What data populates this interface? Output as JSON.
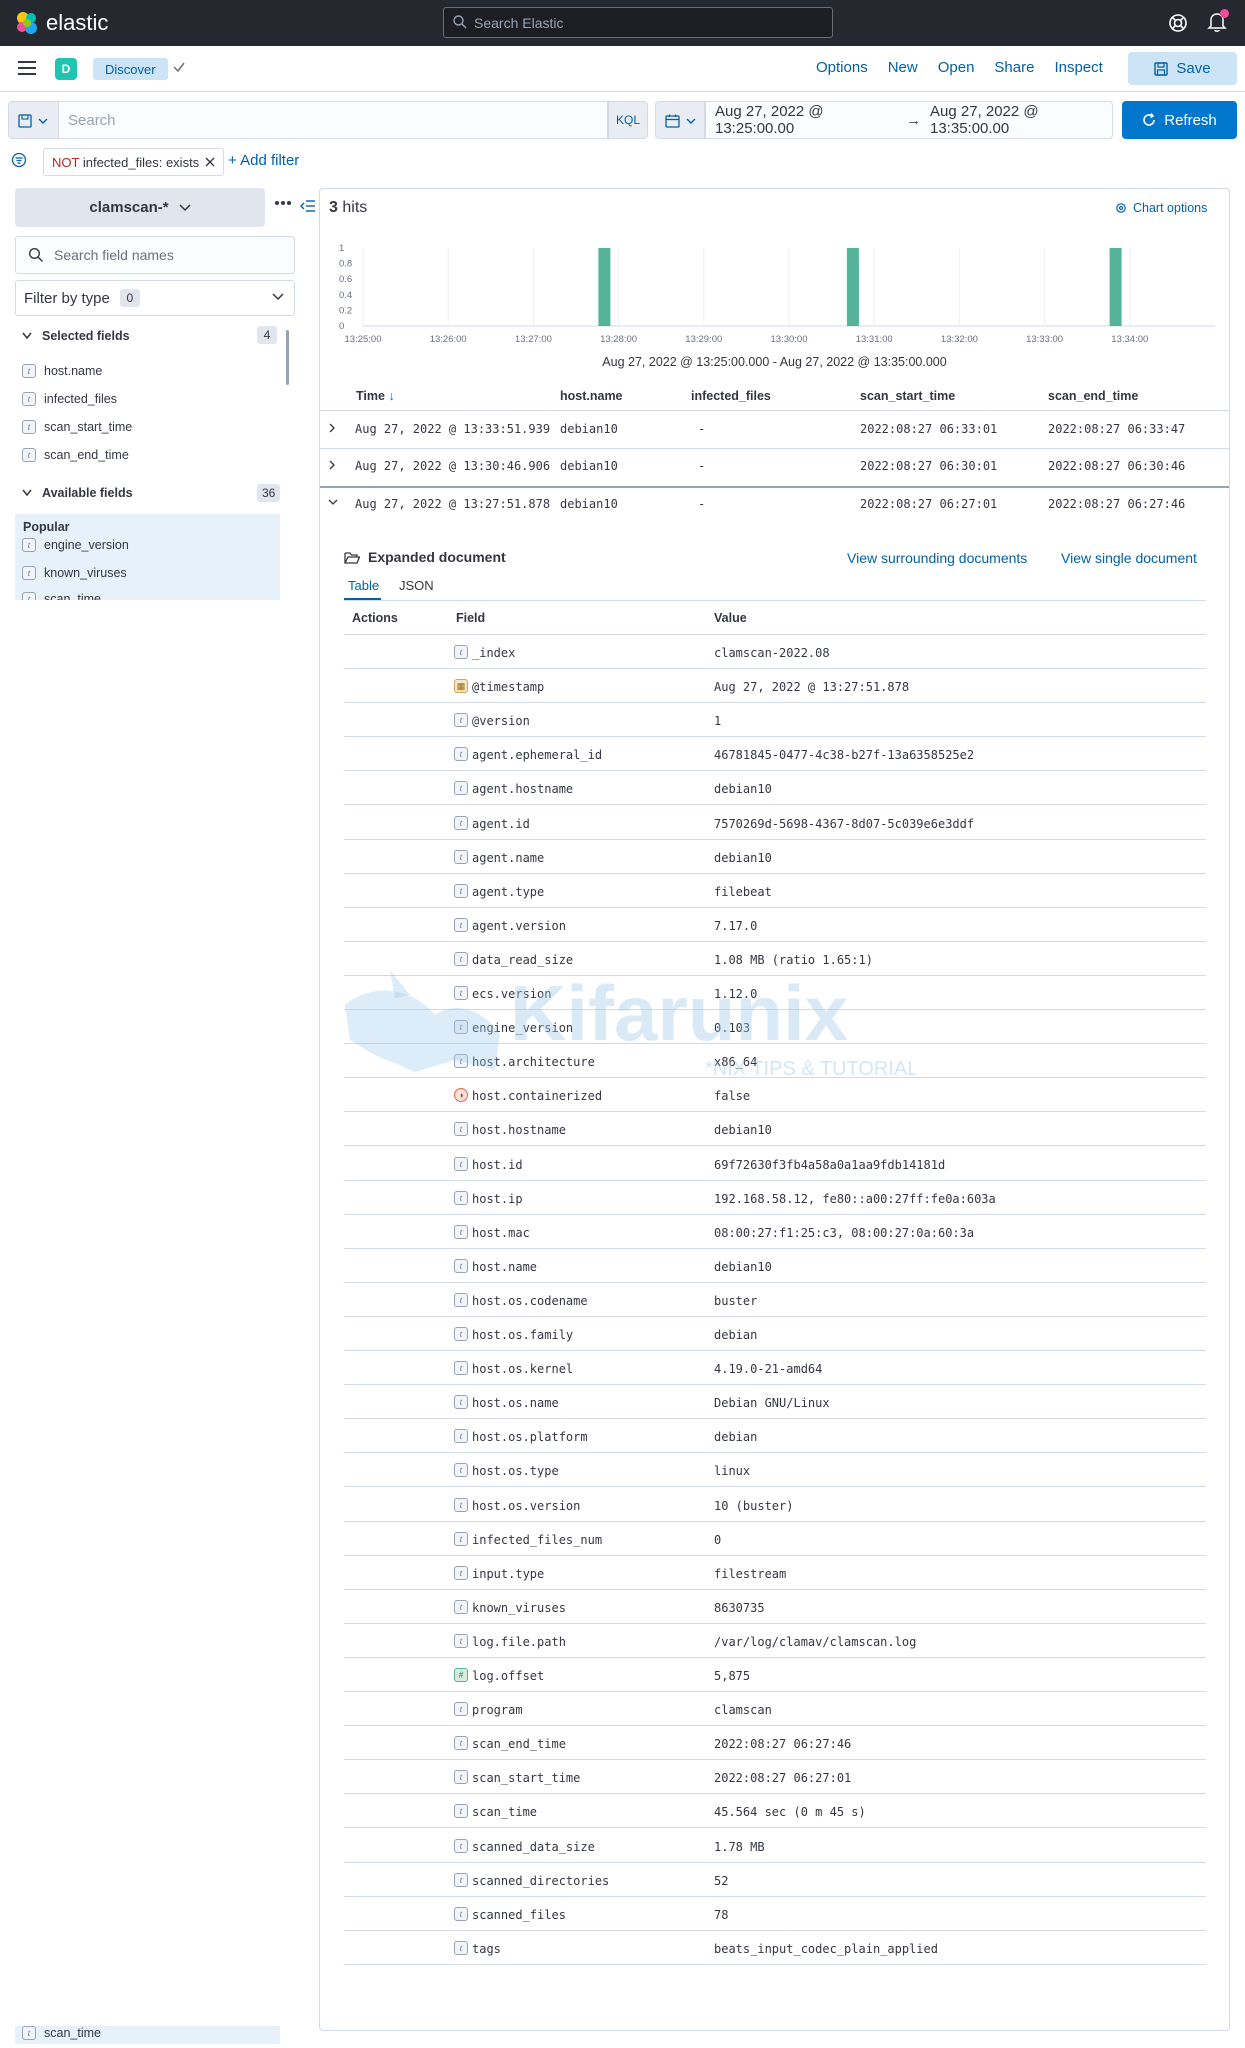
{
  "header": {
    "brand": "elastic",
    "search_placeholder": "Search Elastic",
    "help_icon": "help-icon",
    "notifications_icon": "bell-icon"
  },
  "appbar": {
    "space_badge": "D",
    "breadcrumb": "Discover",
    "links": [
      "Options",
      "New",
      "Open",
      "Share",
      "Inspect"
    ],
    "save_label": "Save"
  },
  "query": {
    "placeholder": "Search",
    "language": "KQL",
    "date_start": "Aug 27, 2022 @ 13:25:00.00",
    "date_arrow": "→",
    "date_end": "Aug 27, 2022 @ 13:35:00.00",
    "refresh_label": "Refresh"
  },
  "filters": {
    "pill_not": "NOT",
    "pill_text": "infected_files: exists",
    "add_filter": "+ Add filter"
  },
  "sidebar": {
    "index_pattern": "clamscan-*",
    "search_placeholder": "Search field names",
    "filter_by_type": "Filter by type",
    "filter_count": "0",
    "selected_title": "Selected fields",
    "selected_count": "4",
    "selected_fields": [
      "host.name",
      "infected_files",
      "scan_start_time",
      "scan_end_time"
    ],
    "available_title": "Available fields",
    "available_count": "36",
    "popular_title": "Popular",
    "popular_fields": [
      "engine_version",
      "known_viruses",
      "scan_time"
    ],
    "bottom_field": "scan_time"
  },
  "hits": {
    "count": "3",
    "label": "hits",
    "chart_options": "Chart options"
  },
  "chart_data": {
    "type": "bar",
    "x_ticks": [
      "13:25:00",
      "13:26:00",
      "13:27:00",
      "13:28:00",
      "13:29:00",
      "13:30:00",
      "13:31:00",
      "13:32:00",
      "13:33:00",
      "13:34:00"
    ],
    "y_ticks": [
      "1",
      "0.8",
      "0.6",
      "0.4",
      "0.2",
      "0"
    ],
    "ylim": [
      0,
      1
    ],
    "bars": [
      {
        "x": "13:27:50",
        "value": 1
      },
      {
        "x": "13:30:45",
        "value": 1
      },
      {
        "x": "13:33:50",
        "value": 1
      }
    ],
    "caption": "Aug 27, 2022 @ 13:25:00.000 - Aug 27, 2022 @ 13:35:00.000",
    "bar_color": "#54b399"
  },
  "table": {
    "columns": [
      "Time",
      "host.name",
      "infected_files",
      "scan_start_time",
      "scan_end_time"
    ],
    "sort_icon": "↓",
    "rows": [
      {
        "time": "Aug 27, 2022 @ 13:33:51.939",
        "host": "debian10",
        "infected": "-",
        "start": "2022:08:27 06:33:01",
        "end": "2022:08:27 06:33:47"
      },
      {
        "time": "Aug 27, 2022 @ 13:30:46.906",
        "host": "debian10",
        "infected": "-",
        "start": "2022:08:27 06:30:01",
        "end": "2022:08:27 06:30:46"
      },
      {
        "time": "Aug 27, 2022 @ 13:27:51.878",
        "host": "debian10",
        "infected": "-",
        "start": "2022:08:27 06:27:01",
        "end": "2022:08:27 06:27:46"
      }
    ]
  },
  "expanded": {
    "title": "Expanded document",
    "surrounding": "View surrounding documents",
    "single": "View single document",
    "tabs": [
      "Table",
      "JSON"
    ],
    "col_actions": "Actions",
    "col_field": "Field",
    "col_value": "Value",
    "fields": [
      {
        "t": "t",
        "name": "_index",
        "value": "clamscan-2022.08"
      },
      {
        "t": "date",
        "name": "@timestamp",
        "value": "Aug 27, 2022 @ 13:27:51.878"
      },
      {
        "t": "t",
        "name": "@version",
        "value": "1"
      },
      {
        "t": "t",
        "name": "agent.ephemeral_id",
        "value": "46781845-0477-4c38-b27f-13a6358525e2"
      },
      {
        "t": "t",
        "name": "agent.hostname",
        "value": "debian10"
      },
      {
        "t": "t",
        "name": "agent.id",
        "value": "7570269d-5698-4367-8d07-5c039e6e3ddf"
      },
      {
        "t": "t",
        "name": "agent.name",
        "value": "debian10"
      },
      {
        "t": "t",
        "name": "agent.type",
        "value": "filebeat"
      },
      {
        "t": "t",
        "name": "agent.version",
        "value": "7.17.0"
      },
      {
        "t": "t",
        "name": "data_read_size",
        "value": "1.08 MB (ratio 1.65:1)"
      },
      {
        "t": "t",
        "name": "ecs.version",
        "value": "1.12.0"
      },
      {
        "t": "t",
        "name": "engine_version",
        "value": "0.103"
      },
      {
        "t": "t",
        "name": "host.architecture",
        "value": "x86_64"
      },
      {
        "t": "bool",
        "name": "host.containerized",
        "value": "false"
      },
      {
        "t": "t",
        "name": "host.hostname",
        "value": "debian10"
      },
      {
        "t": "t",
        "name": "host.id",
        "value": "69f72630f3fb4a58a0a1aa9fdb14181d"
      },
      {
        "t": "t",
        "name": "host.ip",
        "value": "192.168.58.12, fe80::a00:27ff:fe0a:603a"
      },
      {
        "t": "t",
        "name": "host.mac",
        "value": "08:00:27:f1:25:c3, 08:00:27:0a:60:3a"
      },
      {
        "t": "t",
        "name": "host.name",
        "value": "debian10"
      },
      {
        "t": "t",
        "name": "host.os.codename",
        "value": "buster"
      },
      {
        "t": "t",
        "name": "host.os.family",
        "value": "debian"
      },
      {
        "t": "t",
        "name": "host.os.kernel",
        "value": "4.19.0-21-amd64"
      },
      {
        "t": "t",
        "name": "host.os.name",
        "value": "Debian GNU/Linux"
      },
      {
        "t": "t",
        "name": "host.os.platform",
        "value": "debian"
      },
      {
        "t": "t",
        "name": "host.os.type",
        "value": "linux"
      },
      {
        "t": "t",
        "name": "host.os.version",
        "value": "10 (buster)"
      },
      {
        "t": "t",
        "name": "infected_files_num",
        "value": "0"
      },
      {
        "t": "t",
        "name": "input.type",
        "value": "filestream"
      },
      {
        "t": "t",
        "name": "known_viruses",
        "value": "8630735"
      },
      {
        "t": "t",
        "name": "log.file.path",
        "value": "/var/log/clamav/clamscan.log"
      },
      {
        "t": "num",
        "name": "log.offset",
        "value": "5,875"
      },
      {
        "t": "t",
        "name": "program",
        "value": "clamscan"
      },
      {
        "t": "t",
        "name": "scan_end_time",
        "value": "2022:08:27 06:27:46"
      },
      {
        "t": "t",
        "name": "scan_start_time",
        "value": "2022:08:27 06:27:01"
      },
      {
        "t": "t",
        "name": "scan_time",
        "value": "45.564 sec (0 m 45 s)"
      },
      {
        "t": "t",
        "name": "scanned_data_size",
        "value": "1.78 MB"
      },
      {
        "t": "t",
        "name": "scanned_directories",
        "value": "52"
      },
      {
        "t": "t",
        "name": "scanned_files",
        "value": "78"
      },
      {
        "t": "t",
        "name": "tags",
        "value": "beats_input_codec_plain_applied"
      }
    ]
  },
  "watermark": {
    "name": "Kifarunix",
    "tagline": "*NIX TIPS & TUTORIALS"
  }
}
